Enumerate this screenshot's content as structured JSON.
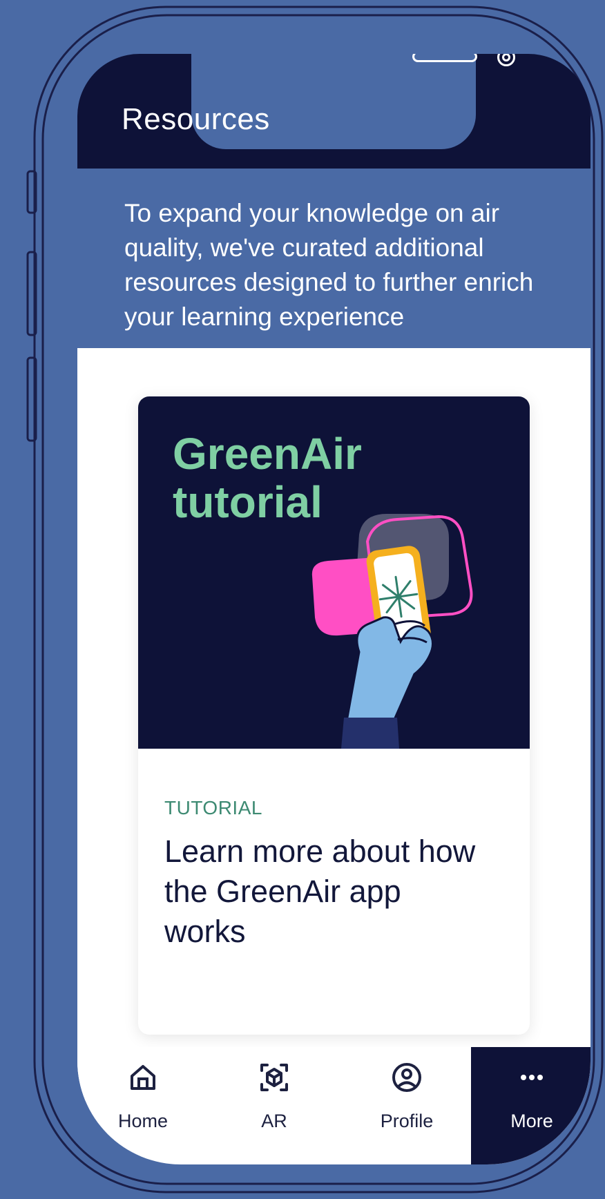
{
  "header": {
    "title": "Resources"
  },
  "intro": {
    "text": "To expand your knowledge on air quality, we've curated additional resources designed to further enrich your learning experience"
  },
  "card": {
    "image_title": "GreenAir tutorial",
    "tag": "TUTORIAL",
    "description": "Learn more about how the GreenAir app works"
  },
  "tabbar": {
    "items": [
      {
        "label": "Home",
        "icon": "home-icon"
      },
      {
        "label": "AR",
        "icon": "ar-cube-icon"
      },
      {
        "label": "Profile",
        "icon": "profile-icon"
      },
      {
        "label": "More",
        "icon": "more-dots-icon"
      }
    ],
    "active_index": 3
  },
  "colors": {
    "background": "#4a6aa5",
    "header": "#0e1238",
    "accent_green": "#7fcfa3",
    "tag_green": "#3d8a72",
    "pink": "#ff4fc4",
    "yellow": "#f5b01e",
    "hand_blue": "#82b8e6"
  }
}
